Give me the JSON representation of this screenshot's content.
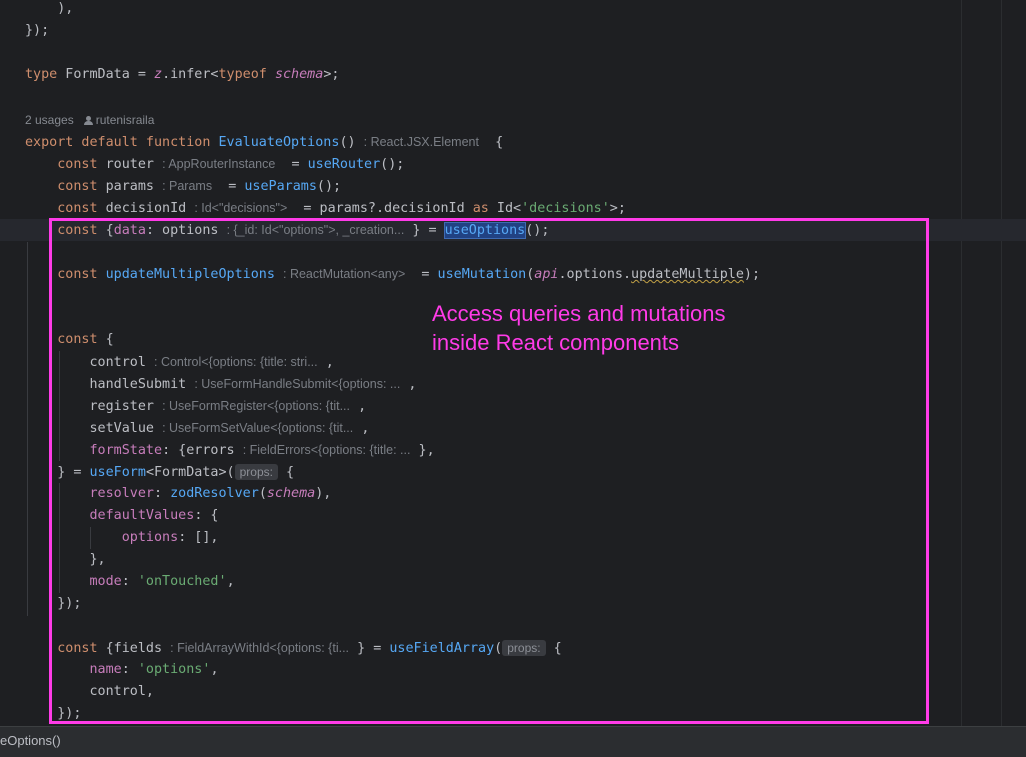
{
  "editor": {
    "usages": "2 usages",
    "author": "rutenisraila",
    "l_paren_close": "),",
    "l_schema_close": "});",
    "l_type": {
      "kw": "type",
      "name": " FormData = ",
      "z": "z",
      "rest": ".infer<",
      "typeof": "typeof",
      "schema": "schema",
      "end": ">;"
    },
    "l_export": {
      "kw": "export default function",
      "fn": "EvaluateOptions",
      "parens": "()",
      "hint": ": React.JSX.Element",
      "brace": "{"
    },
    "l_router": {
      "kw": "const",
      "name": " router",
      "hint": ": AppRouterInstance",
      "eq": "= ",
      "fn": "useRouter",
      "end": "();"
    },
    "l_params": {
      "kw": "const",
      "name": " params",
      "hint": ": Params",
      "eq": "= ",
      "fn": "useParams",
      "end": "();"
    },
    "l_decision": {
      "kw": "const",
      "name": " decisionId",
      "hint": ": Id<\"decisions\">",
      "eq": "= params?.decisionId ",
      "as": "as",
      "id": " Id<",
      "str": "'decisions'",
      "end": ">;"
    },
    "l_options": {
      "kw": "const",
      "open": " {",
      "prop": "data",
      "rest": ": options",
      "hint": ": {_id: Id<\"options\">, _creation...",
      "eq": "} = ",
      "fn": "useOptions",
      "end": "();"
    },
    "l_update": {
      "kw": "const",
      "fn": "updateMultipleOptions",
      "hint": ": ReactMutation<any>",
      "eq": "= ",
      "fn2": "useMutation",
      "paren": "(",
      "api": "api",
      "rest": ".options.",
      "method": "updateMultiple",
      "end": ");"
    },
    "l_const_open": {
      "kw": "const",
      "rest": " {"
    },
    "l_control": {
      "name": "control",
      "hint": ": Control<{options: {title: stri...",
      "end": ","
    },
    "l_handle": {
      "name": "handleSubmit",
      "hint": ": UseFormHandleSubmit<{options: ...",
      "end": ","
    },
    "l_register": {
      "name": "register",
      "hint": ": UseFormRegister<{options: {tit...",
      "end": ","
    },
    "l_setvalue": {
      "name": "setValue",
      "hint": ": UseFormSetValue<{options: {tit...",
      "end": ","
    },
    "l_formstate": {
      "prop": "formState",
      "rest": ": {errors",
      "hint": ": FieldErrors<{options: {title: ...",
      "end": "},"
    },
    "l_useform": {
      "start": "} = ",
      "fn": "useForm",
      "rest": "<FormData>(",
      "chip": "props:",
      "end": "{"
    },
    "l_resolver": {
      "prop": "resolver",
      "colon": ": ",
      "fn": "zodResolver",
      "paren": "(",
      "arg": "schema",
      "end": "),"
    },
    "l_defaults": {
      "prop": "defaultValues",
      "end": ": {"
    },
    "l_opts": {
      "prop": "options",
      "end": ": [],"
    },
    "l_defaults_close": "},",
    "l_mode": {
      "prop": "mode",
      "colon": ": ",
      "str": "'onTouched'",
      "end": ","
    },
    "l_useform_close": "});",
    "l_fields": {
      "kw": "const",
      "rest": " {fields",
      "hint": ": FieldArrayWithId<{options: {ti...",
      "eq": "} = ",
      "fn": "useFieldArray",
      "paren": "(",
      "chip": "props:",
      "end": "{"
    },
    "l_name": {
      "prop": "name",
      "colon": ": ",
      "str": "'options'",
      "end": ","
    },
    "l_control2": "control,",
    "l_fields_close": "});"
  },
  "annotation": {
    "line1": "Access queries and mutations",
    "line2": "inside React components"
  },
  "status": {
    "text": "eOptions()"
  },
  "colors": {
    "background": "#1e1f22",
    "keyword": "#cf8e6d",
    "function": "#56a8f5",
    "property": "#c77dbb",
    "string": "#6aab73",
    "annotation": "#ff3be8"
  }
}
